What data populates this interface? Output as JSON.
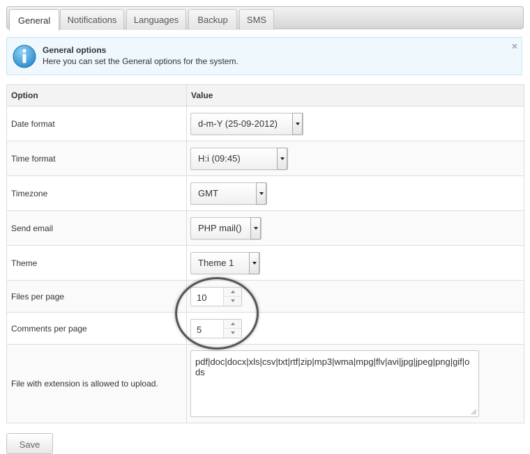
{
  "tabs": [
    {
      "label": "General",
      "active": true
    },
    {
      "label": "Notifications",
      "active": false
    },
    {
      "label": "Languages",
      "active": false
    },
    {
      "label": "Backup",
      "active": false
    },
    {
      "label": "SMS",
      "active": false
    }
  ],
  "info": {
    "icon": "info-icon",
    "title": "General options",
    "text": "Here you can set the General options for the system.",
    "close": "×"
  },
  "table": {
    "headers": {
      "option": "Option",
      "value": "Value"
    },
    "rows": {
      "date_format": {
        "label": "Date format",
        "value": "d-m-Y (25-09-2012)"
      },
      "time_format": {
        "label": "Time format",
        "value": "H:i (09:45)"
      },
      "timezone": {
        "label": "Timezone",
        "value": "GMT"
      },
      "send_email": {
        "label": "Send email",
        "value": "PHP mail()"
      },
      "theme": {
        "label": "Theme",
        "value": "Theme 1"
      },
      "files_per_page": {
        "label": "Files per page",
        "value": "10"
      },
      "comments_per_page": {
        "label": "Comments per page",
        "value": "5"
      },
      "file_extensions": {
        "label": "File with extension is allowed to upload.",
        "value": "pdf|doc|docx|xls|csv|txt|rtf|zip|mp3|wma|mpg|flv|avi|jpg|jpeg|png|gif|ods"
      }
    }
  },
  "save_label": "Save",
  "colors": {
    "accent": "#2f8fd0",
    "info_bg": "#eef8fd"
  }
}
